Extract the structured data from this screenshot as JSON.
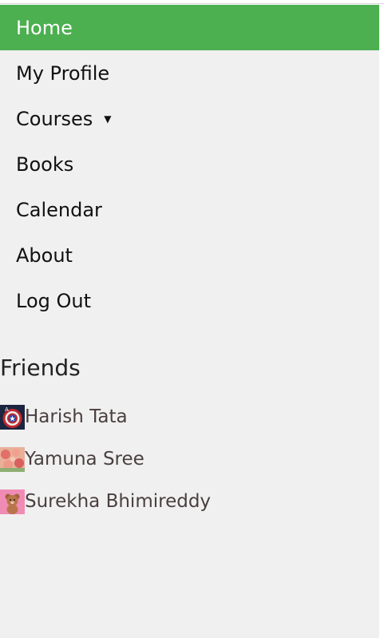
{
  "nav": {
    "items": [
      {
        "label": "Home",
        "active": true
      },
      {
        "label": "My Profile"
      },
      {
        "label": "Courses",
        "dropdown": true
      },
      {
        "label": "Books"
      },
      {
        "label": "Calendar"
      },
      {
        "label": "About"
      },
      {
        "label": "Log Out"
      }
    ],
    "accent_color": "#4caf50"
  },
  "friends": {
    "heading": "Friends",
    "list": [
      {
        "name": "Harish Tata",
        "avatar": "captain-america-shield-icon"
      },
      {
        "name": "Yamuna Sree",
        "avatar": "flowers-photo-icon"
      },
      {
        "name": "Surekha Bhimireddy",
        "avatar": "teddy-bear-photo-icon"
      }
    ]
  }
}
